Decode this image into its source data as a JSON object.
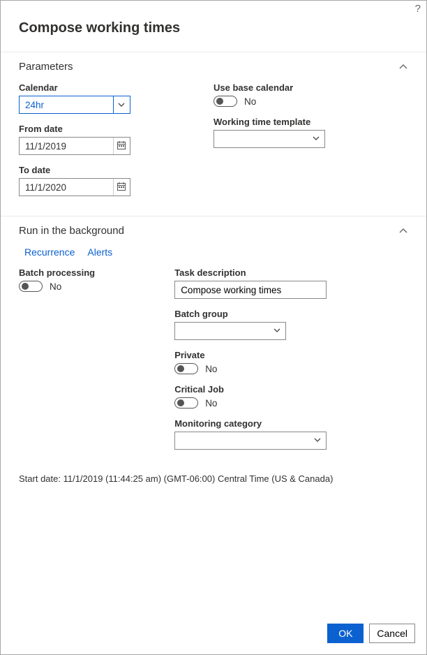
{
  "title": "Compose working times",
  "sections": {
    "parameters": {
      "title": "Parameters"
    },
    "background": {
      "title": "Run in the background"
    }
  },
  "parameters": {
    "calendar_label": "Calendar",
    "calendar_value": "24hr",
    "from_label": "From date",
    "from_value": "11/1/2019",
    "to_label": "To date",
    "to_value": "11/1/2020",
    "use_base_label": "Use base calendar",
    "use_base_value": "No",
    "template_label": "Working time template",
    "template_value": ""
  },
  "links": {
    "recurrence": "Recurrence",
    "alerts": "Alerts"
  },
  "background": {
    "batch_label": "Batch processing",
    "batch_value": "No",
    "task_desc_label": "Task description",
    "task_desc_value": "Compose working times",
    "batch_group_label": "Batch group",
    "batch_group_value": "",
    "private_label": "Private",
    "private_value": "No",
    "critical_label": "Critical Job",
    "critical_value": "No",
    "monitoring_label": "Monitoring category",
    "monitoring_value": ""
  },
  "start_date_line": "Start date: 11/1/2019 (11:44:25 am) (GMT-06:00) Central Time (US & Canada)",
  "footer": {
    "ok": "OK",
    "cancel": "Cancel"
  }
}
